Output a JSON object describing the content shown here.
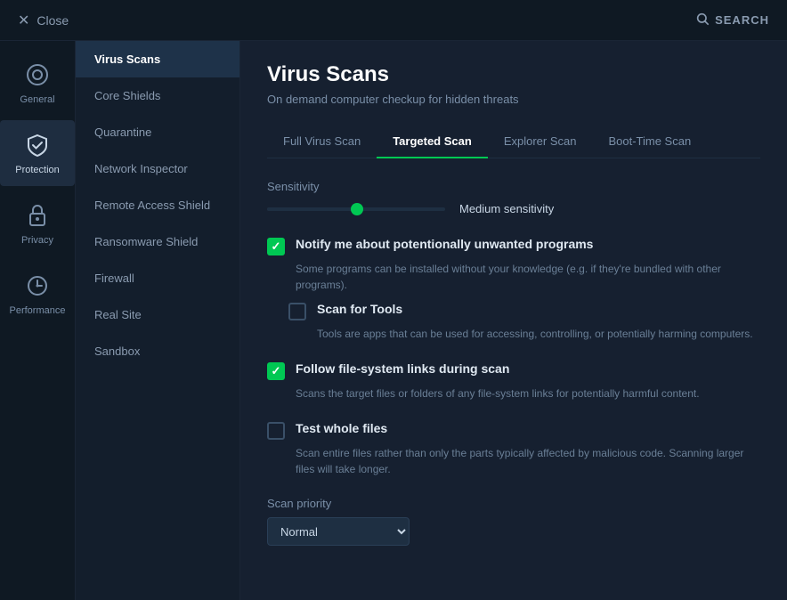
{
  "topbar": {
    "close_label": "Close",
    "search_label": "SEARCH"
  },
  "icon_sidebar": {
    "items": [
      {
        "id": "general",
        "label": "General",
        "icon": "⊙",
        "active": false
      },
      {
        "id": "protection",
        "label": "Protection",
        "icon": "🔒",
        "active": true
      },
      {
        "id": "privacy",
        "label": "Privacy",
        "icon": "☝",
        "active": false
      },
      {
        "id": "performance",
        "label": "Performance",
        "icon": "◎",
        "active": false
      }
    ]
  },
  "nav_sidebar": {
    "items": [
      {
        "id": "virus-scans",
        "label": "Virus Scans",
        "active": true
      },
      {
        "id": "core-shields",
        "label": "Core Shields",
        "active": false
      },
      {
        "id": "quarantine",
        "label": "Quarantine",
        "active": false
      },
      {
        "id": "network-inspector",
        "label": "Network Inspector",
        "active": false
      },
      {
        "id": "remote-access-shield",
        "label": "Remote Access Shield",
        "active": false
      },
      {
        "id": "ransomware-shield",
        "label": "Ransomware Shield",
        "active": false
      },
      {
        "id": "firewall",
        "label": "Firewall",
        "active": false
      },
      {
        "id": "real-site",
        "label": "Real Site",
        "active": false
      },
      {
        "id": "sandbox",
        "label": "Sandbox",
        "active": false
      }
    ]
  },
  "content": {
    "title": "Virus Scans",
    "subtitle": "On demand computer checkup for hidden threats",
    "tabs": [
      {
        "id": "full-virus-scan",
        "label": "Full Virus Scan",
        "active": false
      },
      {
        "id": "targeted-scan",
        "label": "Targeted Scan",
        "active": true
      },
      {
        "id": "explorer-scan",
        "label": "Explorer Scan",
        "active": false
      },
      {
        "id": "boot-time-scan",
        "label": "Boot-Time Scan",
        "active": false
      }
    ],
    "sensitivity": {
      "label": "Sensitivity",
      "value": "Medium sensitivity"
    },
    "options": [
      {
        "id": "notify-pup",
        "checked": true,
        "title": "Notify me about potentionally unwanted programs",
        "description": "Some programs can be installed without your knowledge (e.g. if they're bundled with other programs).",
        "sub_options": [
          {
            "id": "scan-for-tools",
            "checked": false,
            "title": "Scan for Tools",
            "description": "Tools are apps that can be used for accessing, controlling, or potentially harming computers."
          }
        ]
      },
      {
        "id": "follow-links",
        "checked": true,
        "title": "Follow file-system links during scan",
        "description": "Scans the target files or folders of any file-system links for potentially harmful content.",
        "sub_options": []
      },
      {
        "id": "test-whole-files",
        "checked": false,
        "title": "Test whole files",
        "description": "Scan entire files rather than only the parts typically affected by malicious code. Scanning larger files will take longer.",
        "sub_options": []
      }
    ],
    "scan_priority": {
      "label": "Scan priority",
      "placeholder": ""
    }
  }
}
